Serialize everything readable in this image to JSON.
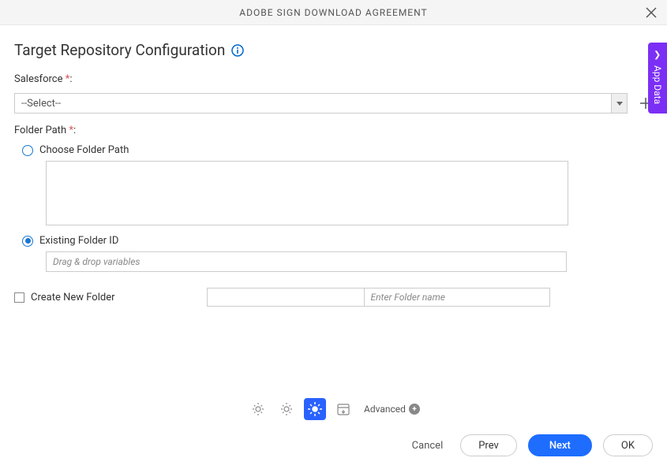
{
  "header": {
    "title": "ADOBE SIGN DOWNLOAD AGREEMENT"
  },
  "page": {
    "title": "Target Repository Configuration"
  },
  "fields": {
    "salesforce": {
      "label": "Salesforce ",
      "placeholder": "--Select--"
    },
    "folderPath": {
      "label": "Folder Path "
    },
    "chooseFolder": {
      "label": "Choose Folder Path"
    },
    "existingFolder": {
      "label": "Existing Folder ID",
      "placeholder": "Drag & drop variables"
    },
    "createNewFolder": {
      "label": "Create New Folder",
      "placeholder": "Enter Folder name"
    }
  },
  "settings": {
    "advanced": "Advanced"
  },
  "footer": {
    "cancel": "Cancel",
    "prev": "Prev",
    "next": "Next",
    "ok": "OK"
  },
  "sideTab": {
    "label": "App Data"
  },
  "required": "*"
}
